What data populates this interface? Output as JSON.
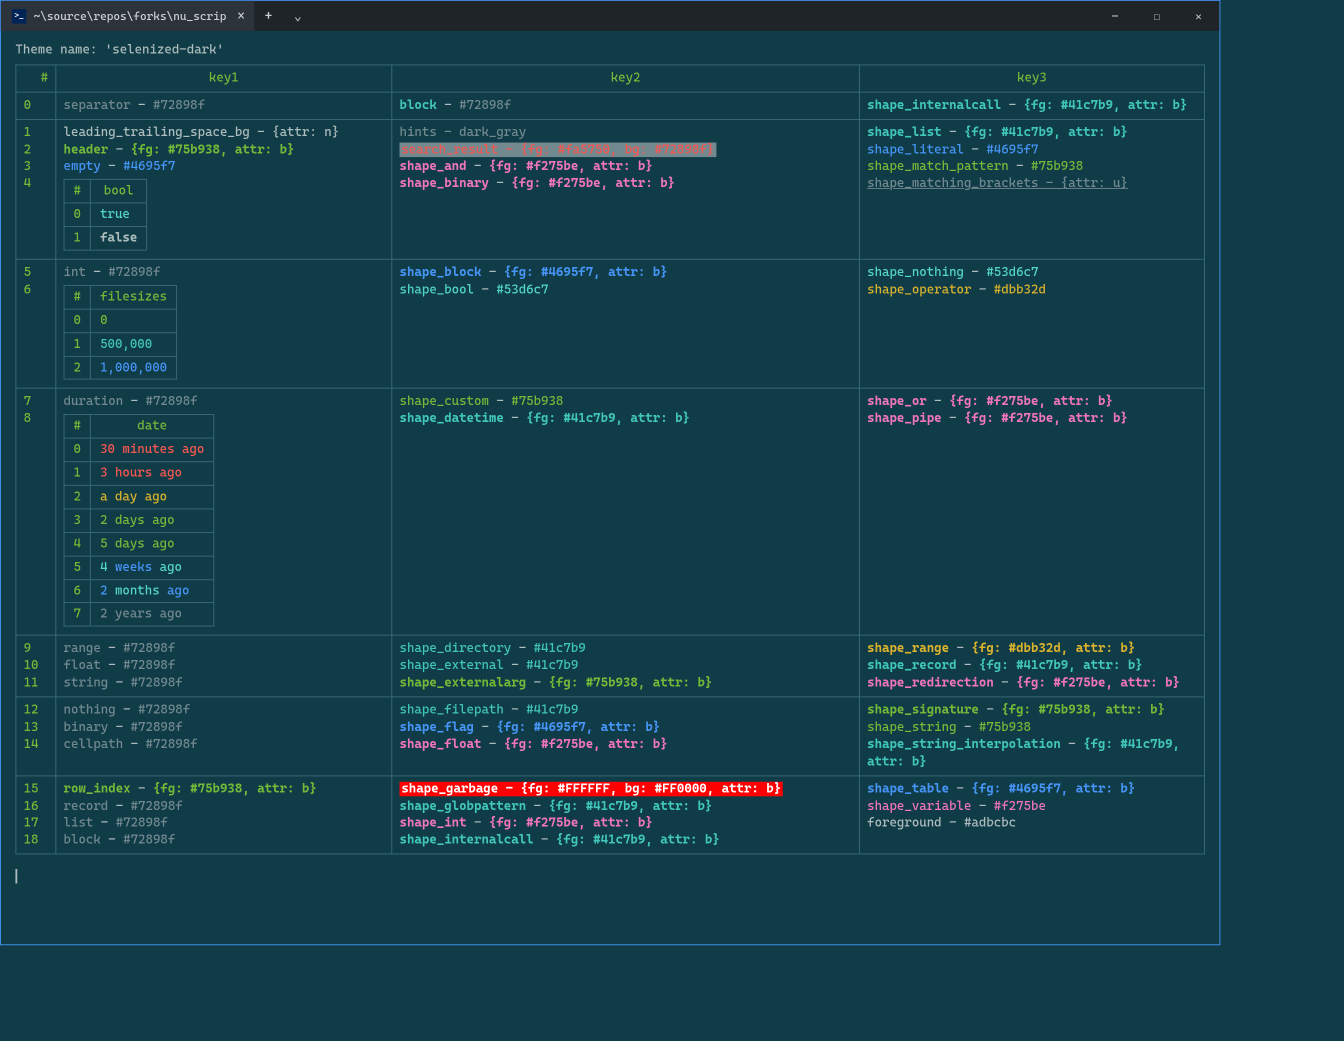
{
  "titlebar": {
    "tab_title": "~\\source\\repos\\forks\\nu_scrip",
    "close": "×",
    "new": "+",
    "dropdown": "⌄",
    "min": "—",
    "max": "☐",
    "closeWin": "✕"
  },
  "theme_label": "Theme name: ",
  "theme_name": "'selenized-dark'",
  "headers": {
    "num": "#",
    "k1": "key1",
    "k2": "key2",
    "k3": "key3"
  },
  "rows": [
    {
      "n": "0",
      "k1": [
        {
          "t": "separator",
          "cls": "c-sep"
        },
        {
          "t": " - ",
          "cls": "c-fg"
        },
        {
          "t": "#72898f",
          "cls": "c-sep"
        }
      ],
      "k2": [
        {
          "t": "block",
          "cls": "c-cyan bold"
        },
        {
          "t": " - ",
          "cls": "c-fg"
        },
        {
          "t": "#72898f",
          "cls": "c-sep"
        }
      ],
      "k3": [
        {
          "t": "shape_internalcall",
          "cls": "c-cyan bold"
        },
        {
          "t": " - ",
          "cls": "c-fg"
        },
        {
          "t": "{fg: #41c7b9, attr: b}",
          "cls": "c-cyan bold"
        }
      ]
    },
    {
      "n": "1",
      "k1": [
        {
          "t": "leading_trailing_space_bg",
          "cls": "c-fg"
        },
        {
          "t": " - ",
          "cls": "c-fg"
        },
        {
          "t": "{attr: n}",
          "cls": "c-fg"
        }
      ],
      "k2": [
        {
          "t": "hints",
          "cls": "c-dim"
        },
        {
          "t": " - ",
          "cls": "c-dim"
        },
        {
          "t": "dark_gray",
          "cls": "c-dim"
        }
      ],
      "k3": [
        {
          "t": "shape_list",
          "cls": "c-cyan bold"
        },
        {
          "t": " - ",
          "cls": "c-fg"
        },
        {
          "t": "{fg: #41c7b9, attr: b}",
          "cls": "c-cyan bold"
        }
      ]
    },
    {
      "n": "2",
      "k1": [
        {
          "t": "header",
          "cls": "c-greenB"
        },
        {
          "t": " - ",
          "cls": "c-fg"
        },
        {
          "t": "{fg: #75b938, attr: b}",
          "cls": "c-greenB"
        }
      ],
      "k2": [
        {
          "t": "search_result - {fg: #fa5750, bg: #72898f}",
          "cls": "hl-search"
        }
      ],
      "k3": [
        {
          "t": "shape_literal",
          "cls": "c-blue"
        },
        {
          "t": " - ",
          "cls": "c-fg"
        },
        {
          "t": "#4695f7",
          "cls": "c-blue"
        }
      ]
    },
    {
      "n": "3",
      "k1": [
        {
          "t": "empty",
          "cls": "c-blue"
        },
        {
          "t": " - ",
          "cls": "c-fg"
        },
        {
          "t": "#4695f7",
          "cls": "c-blue"
        }
      ],
      "k2": [
        {
          "t": "shape_and",
          "cls": "c-pink bold"
        },
        {
          "t": " - ",
          "cls": "c-fg"
        },
        {
          "t": "{fg: #f275be, attr: b}",
          "cls": "c-pink bold"
        }
      ],
      "k3": [
        {
          "t": "shape_match_pattern",
          "cls": "c-green"
        },
        {
          "t": " - ",
          "cls": "c-fg"
        },
        {
          "t": "#75b938",
          "cls": "c-green"
        }
      ]
    },
    {
      "n": "4",
      "k1_sub": {
        "header": [
          "#",
          "bool"
        ],
        "rows": [
          [
            "0",
            [
              {
                "t": "true",
                "cls": "c-cyanL"
              }
            ]
          ],
          [
            "1",
            [
              {
                "t": "false",
                "cls": "c-fg bold"
              }
            ]
          ]
        ]
      },
      "k2": [
        {
          "t": "shape_binary",
          "cls": "c-pink bold"
        },
        {
          "t": " - ",
          "cls": "c-fg"
        },
        {
          "t": "{fg: #f275be, attr: b}",
          "cls": "c-pink bold"
        }
      ],
      "k3": [
        {
          "t": "shape_matching_brackets - {attr: u}",
          "cls": "c-dimU"
        }
      ]
    },
    {
      "n": "5",
      "k1": [
        {
          "t": "int",
          "cls": "c-sep"
        },
        {
          "t": " - ",
          "cls": "c-fg"
        },
        {
          "t": "#72898f",
          "cls": "c-sep"
        }
      ],
      "k2": [
        {
          "t": "shape_block",
          "cls": "c-blue bold"
        },
        {
          "t": " - ",
          "cls": "c-fg"
        },
        {
          "t": "{fg: #4695f7, attr: b}",
          "cls": "c-blue bold"
        }
      ],
      "k3": [
        {
          "t": "shape_nothing",
          "cls": "c-cyanL"
        },
        {
          "t": " - ",
          "cls": "c-fg"
        },
        {
          "t": "#53d6c7",
          "cls": "c-cyanL"
        }
      ]
    },
    {
      "n": "6",
      "k1_sub": {
        "header": [
          "#",
          "filesizes"
        ],
        "align": "right",
        "rows": [
          [
            "0",
            [
              {
                "t": "0",
                "cls": "c-green"
              }
            ]
          ],
          [
            "1",
            [
              {
                "t": "500,000",
                "cls": "c-cyan"
              }
            ]
          ],
          [
            "2",
            [
              {
                "t": "1,000,000",
                "cls": "c-blue"
              }
            ]
          ]
        ]
      },
      "k2": [
        {
          "t": "shape_bool",
          "cls": "c-cyanL"
        },
        {
          "t": " - ",
          "cls": "c-fg"
        },
        {
          "t": "#53d6c7",
          "cls": "c-cyanL"
        }
      ],
      "k3": [
        {
          "t": "shape_operator",
          "cls": "c-yellow"
        },
        {
          "t": " - ",
          "cls": "c-fg"
        },
        {
          "t": "#dbb32d",
          "cls": "c-yellow"
        }
      ]
    },
    {
      "n": "7",
      "k1": [
        {
          "t": "duration",
          "cls": "c-sep"
        },
        {
          "t": " - ",
          "cls": "c-fg"
        },
        {
          "t": "#72898f",
          "cls": "c-sep"
        }
      ],
      "k2": [
        {
          "t": "shape_custom",
          "cls": "c-green"
        },
        {
          "t": " - ",
          "cls": "c-fg"
        },
        {
          "t": "#75b938",
          "cls": "c-green"
        }
      ],
      "k3": [
        {
          "t": "shape_or",
          "cls": "c-pink bold"
        },
        {
          "t": " - ",
          "cls": "c-fg"
        },
        {
          "t": "{fg: #f275be, attr: b}",
          "cls": "c-pink bold"
        }
      ]
    },
    {
      "n": "8",
      "k1_sub": {
        "header": [
          "#",
          "date"
        ],
        "rows": [
          [
            "0",
            [
              {
                "t": "30 minutes ago",
                "cls": "c-red"
              }
            ]
          ],
          [
            "1",
            [
              {
                "t": "3 hours ago",
                "cls": "c-red"
              }
            ]
          ],
          [
            "2",
            [
              {
                "t": "a",
                "cls": "c-yellow"
              },
              {
                "t": " day ",
                "cls": "c-yellow"
              },
              {
                "t": "ago",
                "cls": "c-yellow"
              }
            ]
          ],
          [
            "3",
            [
              {
                "t": "2 days ago",
                "cls": "c-green"
              }
            ]
          ],
          [
            "4",
            [
              {
                "t": "5 days ago",
                "cls": "c-green"
              }
            ]
          ],
          [
            "5",
            [
              {
                "t": "4",
                "cls": "c-cyanL"
              },
              {
                "t": " weeks ",
                "cls": "c-blue"
              },
              {
                "t": "ago",
                "cls": "c-cyanL"
              }
            ]
          ],
          [
            "6",
            [
              {
                "t": "2",
                "cls": "c-blue"
              },
              {
                "t": " months ",
                "cls": "c-cyanL"
              },
              {
                "t": "ago",
                "cls": "c-blue"
              }
            ]
          ],
          [
            "7",
            [
              {
                "t": "2 years ago",
                "cls": "c-dim"
              }
            ]
          ]
        ]
      },
      "k2": [
        {
          "t": "shape_datetime",
          "cls": "c-cyan bold"
        },
        {
          "t": " - ",
          "cls": "c-fg"
        },
        {
          "t": "{fg: #41c7b9, attr: b}",
          "cls": "c-cyan bold"
        }
      ],
      "k3": [
        {
          "t": "shape_pipe",
          "cls": "c-pink bold"
        },
        {
          "t": " - ",
          "cls": "c-fg"
        },
        {
          "t": "{fg: #f275be, attr: b}",
          "cls": "c-pink bold"
        }
      ]
    },
    {
      "n": "9",
      "k1": [
        {
          "t": "range",
          "cls": "c-sep"
        },
        {
          "t": " - ",
          "cls": "c-fg"
        },
        {
          "t": "#72898f",
          "cls": "c-sep"
        }
      ],
      "k2": [
        {
          "t": "shape_directory",
          "cls": "c-cyan"
        },
        {
          "t": " - ",
          "cls": "c-fg"
        },
        {
          "t": "#41c7b9",
          "cls": "c-cyan"
        }
      ],
      "k3": [
        {
          "t": "shape_range",
          "cls": "c-yellow bold"
        },
        {
          "t": " - ",
          "cls": "c-fg"
        },
        {
          "t": "{fg: #dbb32d, attr: b}",
          "cls": "c-yellow bold"
        }
      ]
    },
    {
      "n": "10",
      "k1": [
        {
          "t": "float",
          "cls": "c-sep"
        },
        {
          "t": " - ",
          "cls": "c-fg"
        },
        {
          "t": "#72898f",
          "cls": "c-sep"
        }
      ],
      "k2": [
        {
          "t": "shape_external",
          "cls": "c-cyan"
        },
        {
          "t": " - ",
          "cls": "c-fg"
        },
        {
          "t": "#41c7b9",
          "cls": "c-cyan"
        }
      ],
      "k3": [
        {
          "t": "shape_record",
          "cls": "c-cyan bold"
        },
        {
          "t": " - ",
          "cls": "c-fg"
        },
        {
          "t": "{fg: #41c7b9, attr: b}",
          "cls": "c-cyan bold"
        }
      ]
    },
    {
      "n": "11",
      "k1": [
        {
          "t": "string",
          "cls": "c-sep"
        },
        {
          "t": " - ",
          "cls": "c-fg"
        },
        {
          "t": "#72898f",
          "cls": "c-sep"
        }
      ],
      "k2": [
        {
          "t": "shape_externalarg",
          "cls": "c-greenB"
        },
        {
          "t": " - ",
          "cls": "c-fg"
        },
        {
          "t": "{fg: #75b938, attr: b}",
          "cls": "c-greenB"
        }
      ],
      "k3": [
        {
          "t": "shape_redirection",
          "cls": "c-pink bold"
        },
        {
          "t": " - ",
          "cls": "c-fg"
        },
        {
          "t": "{fg: #f275be, attr: b}",
          "cls": "c-pink bold"
        }
      ]
    },
    {
      "n": "12",
      "k1": [
        {
          "t": "nothing",
          "cls": "c-sep"
        },
        {
          "t": " - ",
          "cls": "c-fg"
        },
        {
          "t": "#72898f",
          "cls": "c-sep"
        }
      ],
      "k2": [
        {
          "t": "shape_filepath",
          "cls": "c-cyan"
        },
        {
          "t": " - ",
          "cls": "c-fg"
        },
        {
          "t": "#41c7b9",
          "cls": "c-cyan"
        }
      ],
      "k3": [
        {
          "t": "shape_signature",
          "cls": "c-greenB"
        },
        {
          "t": " - ",
          "cls": "c-fg"
        },
        {
          "t": "{fg: #75b938, attr: b}",
          "cls": "c-greenB"
        }
      ]
    },
    {
      "n": "13",
      "k1": [
        {
          "t": "binary",
          "cls": "c-sep"
        },
        {
          "t": " - ",
          "cls": "c-fg"
        },
        {
          "t": "#72898f",
          "cls": "c-sep"
        }
      ],
      "k2": [
        {
          "t": "shape_flag",
          "cls": "c-blue bold"
        },
        {
          "t": " - ",
          "cls": "c-fg"
        },
        {
          "t": "{fg: #4695f7, attr: b}",
          "cls": "c-blue bold"
        }
      ],
      "k3": [
        {
          "t": "shape_string",
          "cls": "c-green"
        },
        {
          "t": " - ",
          "cls": "c-fg"
        },
        {
          "t": "#75b938",
          "cls": "c-green"
        }
      ]
    },
    {
      "n": "14",
      "k1": [
        {
          "t": "cellpath",
          "cls": "c-sep"
        },
        {
          "t": " - ",
          "cls": "c-fg"
        },
        {
          "t": "#72898f",
          "cls": "c-sep"
        }
      ],
      "k2": [
        {
          "t": "shape_float",
          "cls": "c-pink bold"
        },
        {
          "t": " - ",
          "cls": "c-fg"
        },
        {
          "t": "{fg: #f275be, attr: b}",
          "cls": "c-pink bold"
        }
      ],
      "k3": [
        {
          "t": "shape_string_interpolation",
          "cls": "c-cyan bold"
        },
        {
          "t": " - ",
          "cls": "c-fg"
        },
        {
          "t": "{fg: #41c7b9, attr: b}",
          "cls": "c-cyan bold"
        }
      ]
    },
    {
      "n": "15",
      "k1": [
        {
          "t": "row_index",
          "cls": "c-greenB"
        },
        {
          "t": " - ",
          "cls": "c-fg"
        },
        {
          "t": "{fg: #75b938, attr: b}",
          "cls": "c-greenB"
        }
      ],
      "k2": [
        {
          "t": "shape_garbage - {fg: #FFFFFF, bg: #FF0000, attr: b}",
          "cls": "hl-garbage"
        }
      ],
      "k3": [
        {
          "t": "shape_table",
          "cls": "c-blue bold"
        },
        {
          "t": " - ",
          "cls": "c-fg"
        },
        {
          "t": "{fg: #4695f7, attr: b}",
          "cls": "c-blue bold"
        }
      ]
    },
    {
      "n": "16",
      "k1": [
        {
          "t": "record",
          "cls": "c-sep"
        },
        {
          "t": " - ",
          "cls": "c-fg"
        },
        {
          "t": "#72898f",
          "cls": "c-sep"
        }
      ],
      "k2": [
        {
          "t": "shape_globpattern",
          "cls": "c-cyan bold"
        },
        {
          "t": " - ",
          "cls": "c-fg"
        },
        {
          "t": "{fg: #41c7b9, attr: b}",
          "cls": "c-cyan bold"
        }
      ],
      "k3": [
        {
          "t": "shape_variable",
          "cls": "c-pink"
        },
        {
          "t": " - ",
          "cls": "c-fg"
        },
        {
          "t": "#f275be",
          "cls": "c-pink"
        }
      ]
    },
    {
      "n": "17",
      "k1": [
        {
          "t": "list",
          "cls": "c-sep"
        },
        {
          "t": " - ",
          "cls": "c-fg"
        },
        {
          "t": "#72898f",
          "cls": "c-sep"
        }
      ],
      "k2": [
        {
          "t": "shape_int",
          "cls": "c-pink bold"
        },
        {
          "t": " - ",
          "cls": "c-fg"
        },
        {
          "t": "{fg: #f275be, attr: b}",
          "cls": "c-pink bold"
        }
      ],
      "k3": []
    },
    {
      "n": "18",
      "k1": [
        {
          "t": "block",
          "cls": "c-sep"
        },
        {
          "t": " - ",
          "cls": "c-fg"
        },
        {
          "t": "#72898f",
          "cls": "c-sep"
        }
      ],
      "k2": [
        {
          "t": "shape_internalcall",
          "cls": "c-cyan bold"
        },
        {
          "t": " - ",
          "cls": "c-fg"
        },
        {
          "t": "{fg: #41c7b9, attr: b}",
          "cls": "c-cyan bold"
        }
      ],
      "k3": [
        {
          "t": "foreground",
          "cls": "c-fg"
        },
        {
          "t": " - ",
          "cls": "c-fg"
        },
        {
          "t": "#adbcbc",
          "cls": "c-fg"
        }
      ]
    }
  ],
  "groups": [
    {
      "start": 0,
      "k1rows": [
        0
      ],
      "k2rows": [
        0
      ],
      "k3rows": [
        0
      ]
    },
    {
      "start": 1,
      "k1rows": [
        1,
        2,
        3,
        4
      ],
      "k2rows": [
        1,
        2,
        3,
        4
      ],
      "k3rows": [
        1,
        2,
        3,
        4
      ]
    },
    {
      "start": 5,
      "k1rows": [
        5,
        6
      ],
      "k2rows": [
        5,
        6
      ],
      "k3rows": [
        5,
        6
      ]
    },
    {
      "start": 7,
      "k1rows": [
        7,
        8
      ],
      "k2rows": [
        7,
        8
      ],
      "k3rows": [
        7,
        8
      ]
    },
    {
      "start": 9,
      "k1rows": [
        9,
        10,
        11
      ],
      "k2rows": [
        9,
        10,
        11
      ],
      "k3rows": [
        9,
        10,
        11
      ]
    },
    {
      "start": 12,
      "k1rows": [
        12,
        13,
        14
      ],
      "k2rows": [
        12,
        13,
        14
      ],
      "k3rows": [
        12,
        13,
        14
      ]
    },
    {
      "start": 15,
      "k1rows": [
        15,
        16,
        17,
        18
      ],
      "k2rows": [
        15,
        16,
        17,
        18
      ],
      "k3rows": [
        15,
        16,
        17,
        18
      ]
    }
  ]
}
